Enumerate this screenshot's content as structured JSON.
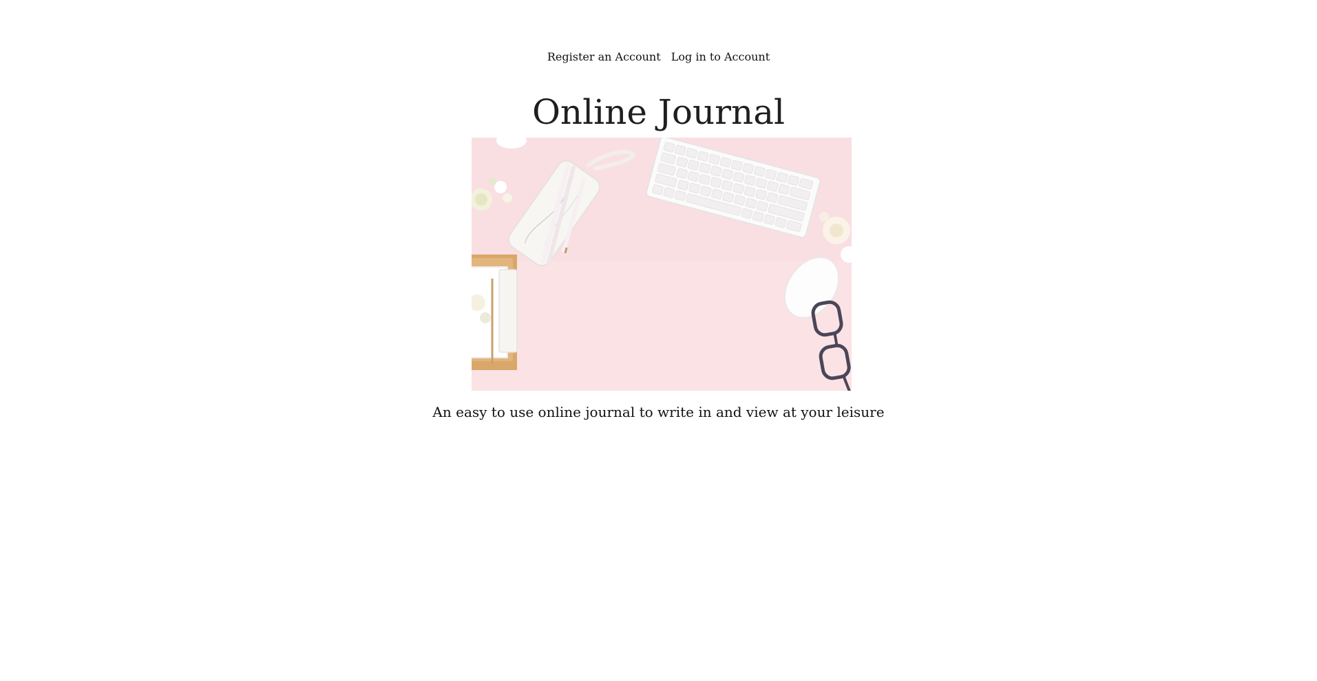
{
  "nav": {
    "register_label": "Register an Account",
    "login_label": "Log in to Account"
  },
  "header": {
    "title": "Online Journal"
  },
  "hero": {
    "description": "Flat lay of a pink desk with a pencil pouch, pens, keyboard, mouse, notebook, flowers and glasses"
  },
  "main": {
    "tagline": "An easy to use online journal to write in and view at your leisure"
  },
  "colors": {
    "background": "#ffffff",
    "hero_background": "#f9dfe2",
    "text": "#1a1a1a"
  }
}
